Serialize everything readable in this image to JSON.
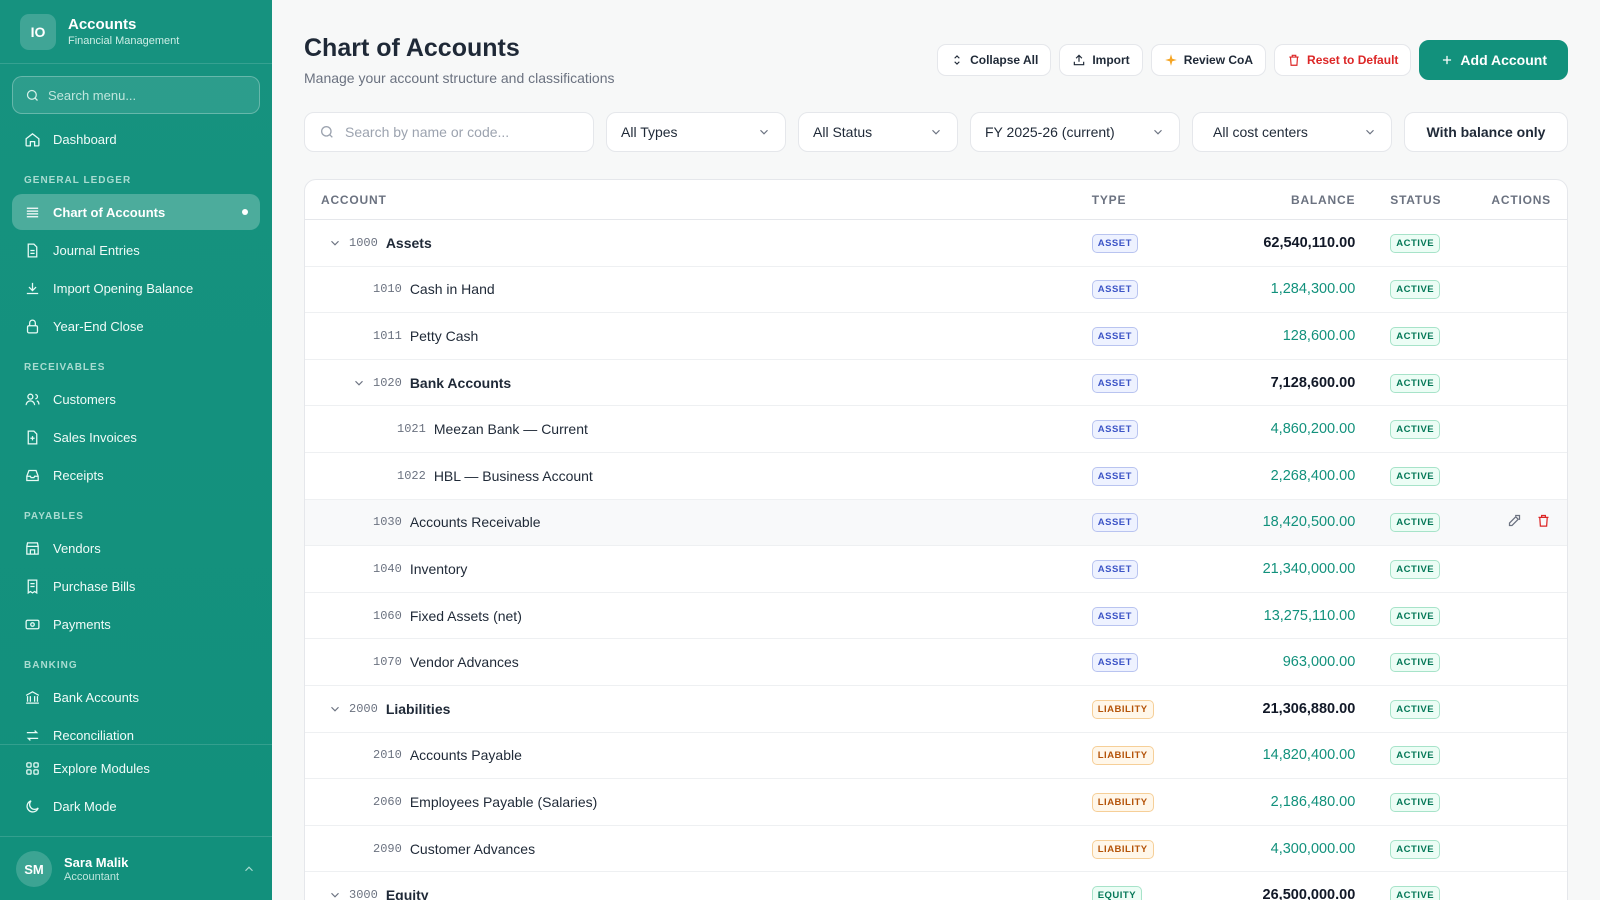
{
  "app": {
    "logo_initials": "IO",
    "title": "Accounts",
    "subtitle": "Financial Management"
  },
  "sidebar": {
    "search_placeholder": "Search menu...",
    "dashboard": "Dashboard",
    "sections": {
      "general_ledger": "GENERAL LEDGER",
      "receivables": "RECEIVABLES",
      "payables": "PAYABLES",
      "banking": "BANKING"
    },
    "gl_items": [
      "Chart of Accounts",
      "Journal Entries",
      "Import Opening Balance",
      "Year-End Close"
    ],
    "rec_items": [
      "Customers",
      "Sales Invoices",
      "Receipts"
    ],
    "pay_items": [
      "Vendors",
      "Purchase Bills",
      "Payments"
    ],
    "bank_items": [
      "Bank Accounts",
      "Reconciliation"
    ],
    "bottom_items": [
      "Explore Modules",
      "Dark Mode"
    ],
    "user": {
      "initials": "SM",
      "name": "Sara Malik",
      "role": "Accountant"
    }
  },
  "header": {
    "title": "Chart of Accounts",
    "subtitle": "Manage your account structure and classifications",
    "collapse_all": "Collapse All",
    "import": "Import",
    "review": "Review CoA",
    "reset": "Reset to Default",
    "add": "Add Account"
  },
  "filters": {
    "search_placeholder": "Search by name or code...",
    "type": "All Types",
    "status": "All Status",
    "fiscal_year": "FY 2025-26 (current)",
    "cost_center": "All cost centers",
    "balance_toggle": "With balance only"
  },
  "table": {
    "headers": {
      "account": "ACCOUNT",
      "type": "TYPE",
      "balance": "BALANCE",
      "status": "STATUS",
      "actions": "ACTIONS"
    },
    "rows": [
      {
        "code": "1000",
        "name": "Assets",
        "type": "ASSET",
        "balance": "62,540,110.00",
        "status": "ACTIVE"
      },
      {
        "code": "1010",
        "name": "Cash in Hand",
        "type": "ASSET",
        "balance": "1,284,300.00",
        "status": "ACTIVE"
      },
      {
        "code": "1011",
        "name": "Petty Cash",
        "type": "ASSET",
        "balance": "128,600.00",
        "status": "ACTIVE"
      },
      {
        "code": "1020",
        "name": "Bank Accounts",
        "type": "ASSET",
        "balance": "7,128,600.00",
        "status": "ACTIVE"
      },
      {
        "code": "1021",
        "name": "Meezan Bank — Current",
        "type": "ASSET",
        "balance": "4,860,200.00",
        "status": "ACTIVE"
      },
      {
        "code": "1022",
        "name": "HBL — Business Account",
        "type": "ASSET",
        "balance": "2,268,400.00",
        "status": "ACTIVE"
      },
      {
        "code": "1030",
        "name": "Accounts Receivable",
        "type": "ASSET",
        "balance": "18,420,500.00",
        "status": "ACTIVE"
      },
      {
        "code": "1040",
        "name": "Inventory",
        "type": "ASSET",
        "balance": "21,340,000.00",
        "status": "ACTIVE"
      },
      {
        "code": "1060",
        "name": "Fixed Assets (net)",
        "type": "ASSET",
        "balance": "13,275,110.00",
        "status": "ACTIVE"
      },
      {
        "code": "1070",
        "name": "Vendor Advances",
        "type": "ASSET",
        "balance": "963,000.00",
        "status": "ACTIVE"
      },
      {
        "code": "2000",
        "name": "Liabilities",
        "type": "LIABILITY",
        "balance": "21,306,880.00",
        "status": "ACTIVE"
      },
      {
        "code": "2010",
        "name": "Accounts Payable",
        "type": "LIABILITY",
        "balance": "14,820,400.00",
        "status": "ACTIVE"
      },
      {
        "code": "2060",
        "name": "Employees Payable (Salaries)",
        "type": "LIABILITY",
        "balance": "2,186,480.00",
        "status": "ACTIVE"
      },
      {
        "code": "2090",
        "name": "Customer Advances",
        "type": "LIABILITY",
        "balance": "4,300,000.00",
        "status": "ACTIVE"
      },
      {
        "code": "3000",
        "name": "Equity",
        "type": "EQUITY",
        "balance": "26,500,000.00",
        "status": "ACTIVE"
      }
    ]
  },
  "colors": {
    "brand": "#12917c",
    "danger": "#dc2626",
    "review_star": "#f5a524"
  }
}
